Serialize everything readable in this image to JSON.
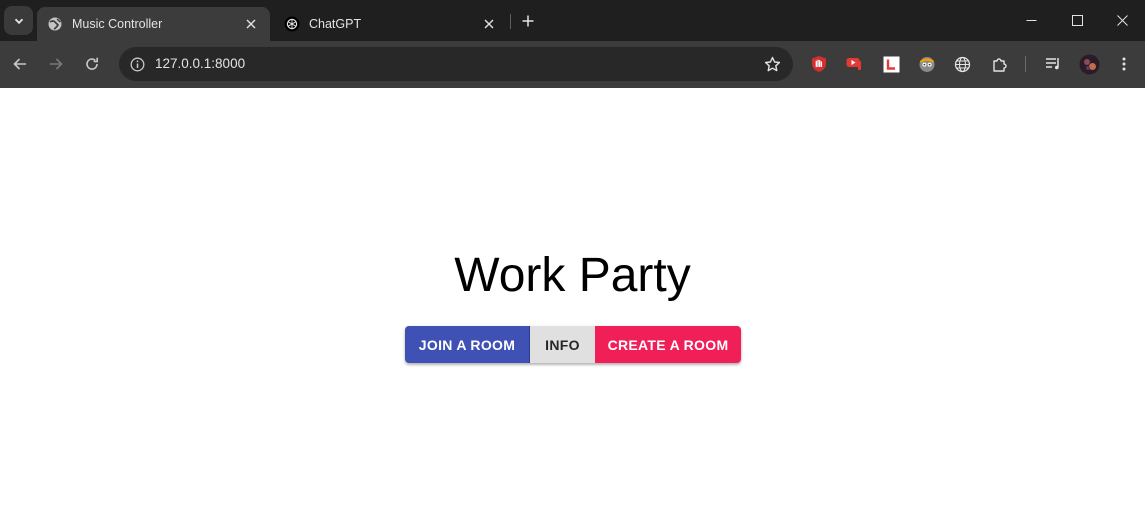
{
  "browser": {
    "tabs": [
      {
        "title": "Music Controller",
        "favicon": "globe-icon",
        "active": true
      },
      {
        "title": "ChatGPT",
        "favicon": "openai-icon",
        "active": false
      }
    ],
    "url": "127.0.0.1:8000",
    "extensions": [
      "ublock-icon",
      "youtube-dislike-icon",
      "language-reactor-icon",
      "avatar-extension-icon",
      "globe-extension-icon",
      "puzzle-extensions-icon"
    ],
    "colors": {
      "tabstrip": "#1f1f1f",
      "toolbar": "#3c3c3c",
      "omnibox": "#282828"
    }
  },
  "page": {
    "title": "Work Party",
    "buttons": {
      "join": "JOIN A ROOM",
      "info": "INFO",
      "create": "CREATE A ROOM"
    },
    "colors": {
      "primary": "#3f51b5",
      "secondary": "#f01f58",
      "neutral": "#e0e0e0"
    }
  }
}
